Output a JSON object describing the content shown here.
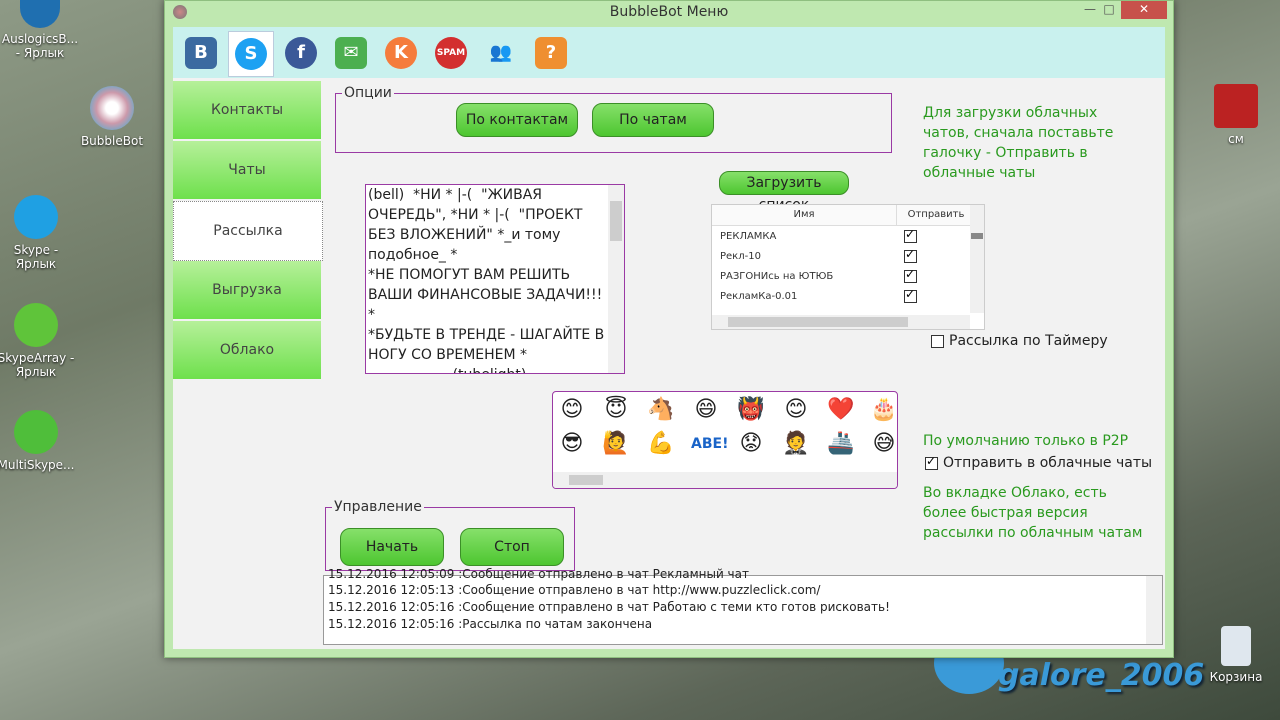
{
  "desktop": {
    "icons": [
      {
        "label": "AuslogicsB... - Ярлык"
      },
      {
        "label": "BubbleBot"
      },
      {
        "label": "Skype - Ярлык"
      },
      {
        "label": "SkypeArray - Ярлык"
      },
      {
        "label": "MultiSkype..."
      },
      {
        "label": "см"
      },
      {
        "label": "Корзина"
      }
    ],
    "watermark": "galore_2006"
  },
  "window": {
    "title": "BubbleBot Меню",
    "minimize": "—",
    "maximize": "□",
    "close": "✕"
  },
  "toolbar": {
    "tools": [
      {
        "name": "vk",
        "glyph": "B",
        "color": "#3b6aa0"
      },
      {
        "name": "skype",
        "glyph": "S",
        "color": "#1da1f2"
      },
      {
        "name": "facebook",
        "glyph": "f",
        "color": "#3b5998"
      },
      {
        "name": "mail",
        "glyph": "✉",
        "color": "#4caf50"
      },
      {
        "name": "k",
        "glyph": "K",
        "color": "#f57c3c"
      },
      {
        "name": "spam",
        "glyph": "SPAM",
        "color": "#d32f2f"
      },
      {
        "name": "users",
        "glyph": "👥",
        "color": "#7cb342"
      },
      {
        "name": "help",
        "glyph": "?",
        "color": "#ef8f30"
      }
    ]
  },
  "sidebar": {
    "items": [
      {
        "label": "Контакты"
      },
      {
        "label": "Чаты"
      },
      {
        "label": "Рассылка"
      },
      {
        "label": "Выгрузка"
      },
      {
        "label": "Облако"
      }
    ]
  },
  "options": {
    "label": "Опции",
    "by_contacts": "По контактам",
    "by_chats": "По чатам"
  },
  "message_text": "(bell)  *НИ * |-(  \"ЖИВАЯ ОЧЕРЕДЬ\", *НИ * |-(  \"ПРОЕКТ БЕЗ ВЛОЖЕНИЙ\" *_и тому подобное_ *\n*НЕ ПОМОГУТ ВАМ РЕШИТЬ ВАШИ ФИНАНСОВЫЕ ЗАДАЧИ!!! *\n*БУДЬТЕ В ТРЕНДЕ - ШАГАЙТЕ В НОГУ СО ВРЕМЕНЕМ *\n                   (tubelight)\n(tubelight) (tubelight) (tubelight)",
  "hint_top": "Для загрузки облачных чатов, сначала поставьте галочку - Отправить в облачные чаты",
  "load_list": "Загрузить список",
  "grid": {
    "col_name": "Имя",
    "col_send": "Отправить",
    "rows": [
      {
        "name": "РЕКЛАМКА",
        "checked": true
      },
      {
        "name": "Рекл-10",
        "checked": true
      },
      {
        "name": "РАЗГОНИсь на ЮТЮБ",
        "checked": true
      },
      {
        "name": "РекламКа-0.01",
        "checked": true
      }
    ]
  },
  "timer_mailing": {
    "label": "Рассылка по Таймеру",
    "checked": false
  },
  "emojis": [
    "😊",
    "😇",
    "🐴",
    "😄",
    "👹",
    "😊",
    "❤️",
    "🎂",
    "😎",
    "🙋",
    "💪",
    "ABE!",
    "😟",
    "🤵",
    "🚢",
    "😅"
  ],
  "hint_p2p": "По умолчанию только в P2P",
  "send_cloud": {
    "label": "Отправить в облачные чаты",
    "checked": true
  },
  "hint_cloud": "Во вкладке Облако, есть более быстрая версия рассылки по облачным чатам",
  "control": {
    "label": "Управление",
    "start": "Начать",
    "stop": "Стоп"
  },
  "log": [
    "15.12.2016 12:05:09 :Сообщение отправлено в чат Рекламный чат",
    "15.12.2016 12:05:13 :Сообщение отправлено в чат http://www.puzzleclick.com/",
    "15.12.2016 12:05:16 :Сообщение отправлено в чат Работаю с теми кто готов рисковать!",
    "15.12.2016 12:05:16 :Рассылка по чатам закончена"
  ]
}
